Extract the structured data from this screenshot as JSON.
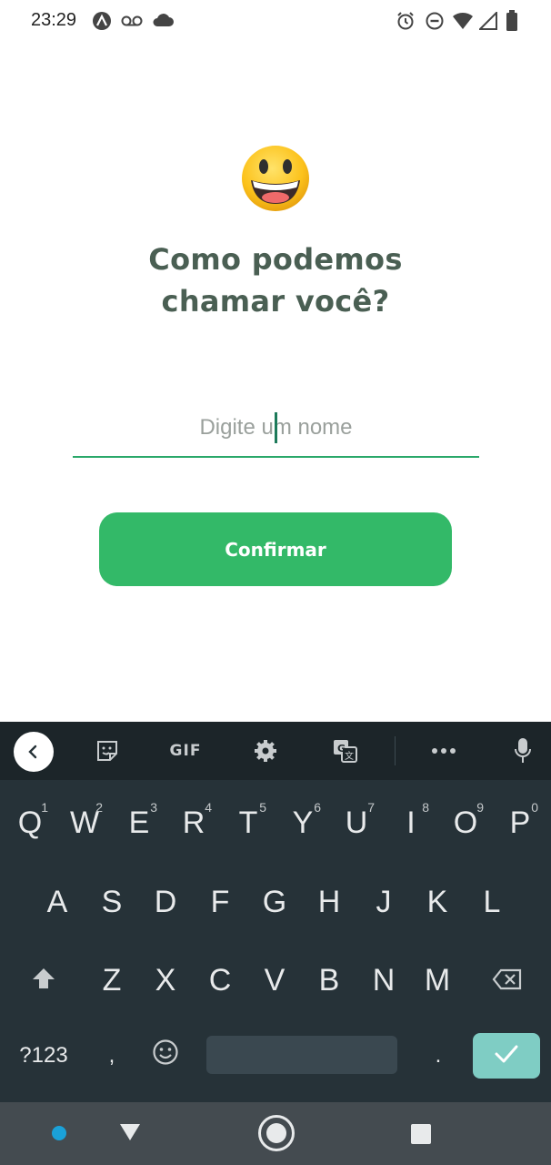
{
  "status_bar": {
    "time": "23:29",
    "icons": [
      "vpn-icon",
      "voicemail-icon",
      "cloud-icon",
      "alarm-icon",
      "do-not-disturb-icon",
      "wifi-icon",
      "signal-icon",
      "battery-icon"
    ]
  },
  "main": {
    "emoji": "grinning-face-emoji",
    "title_line1": "Como podemos",
    "title_line2": "chamar você?",
    "name_placeholder": "Digite um nome",
    "name_value": "",
    "confirm_label": "Confirmar"
  },
  "keyboard": {
    "toolbar": [
      "back-icon",
      "sticker-icon",
      "GIF",
      "settings-icon",
      "translate-icon",
      "more-icon",
      "mic-icon"
    ],
    "gif_label": "GIF",
    "row1": [
      {
        "k": "Q",
        "h": "1"
      },
      {
        "k": "W",
        "h": "2"
      },
      {
        "k": "E",
        "h": "3"
      },
      {
        "k": "R",
        "h": "4"
      },
      {
        "k": "T",
        "h": "5"
      },
      {
        "k": "Y",
        "h": "6"
      },
      {
        "k": "U",
        "h": "7"
      },
      {
        "k": "I",
        "h": "8"
      },
      {
        "k": "O",
        "h": "9"
      },
      {
        "k": "P",
        "h": "0"
      }
    ],
    "row2": [
      "A",
      "S",
      "D",
      "F",
      "G",
      "H",
      "J",
      "K",
      "L"
    ],
    "row3": [
      "Z",
      "X",
      "C",
      "V",
      "B",
      "N",
      "M"
    ],
    "symbols_label": "?123",
    "comma_label": ",",
    "period_label": ".",
    "accent_color": "#7fcdc4"
  },
  "colors": {
    "title": "#4a5f53",
    "button": "#33b968",
    "underline": "#2aa86a",
    "keyboard_bg": "#263238"
  }
}
